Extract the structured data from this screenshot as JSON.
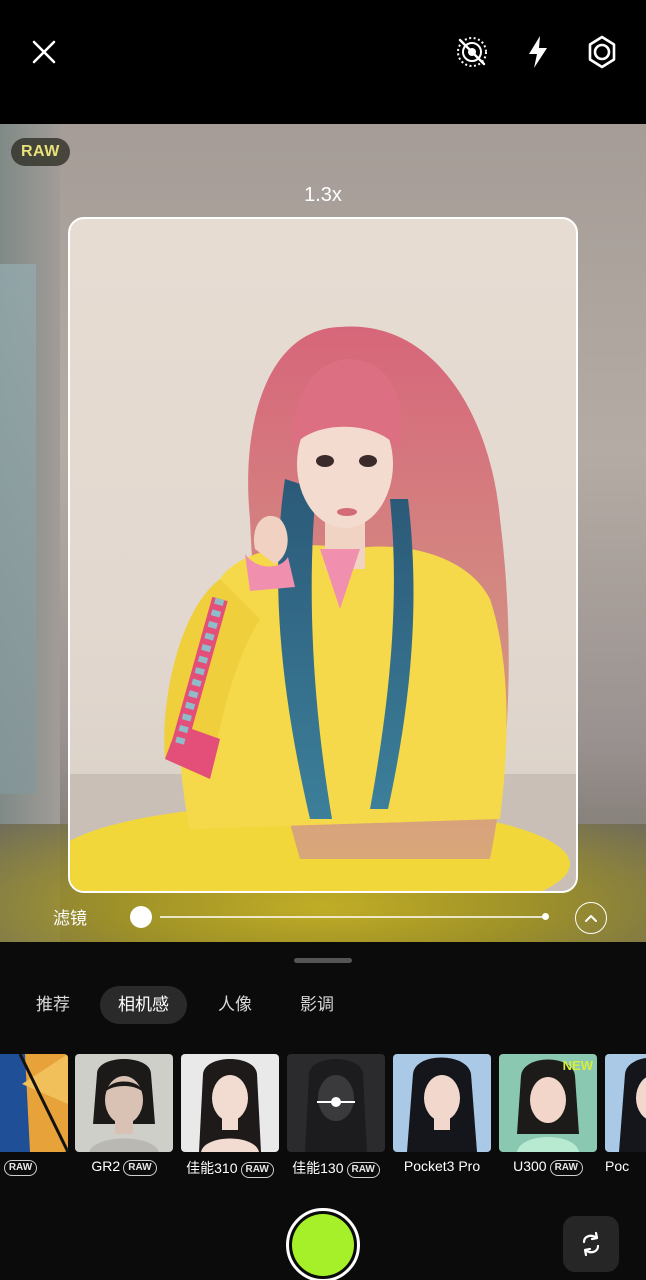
{
  "topbar": {
    "close_icon": "close-icon",
    "live_off_icon": "live-photo-off-icon",
    "flash_icon": "flash-icon",
    "settings_icon": "settings-icon"
  },
  "viewfinder": {
    "raw_badge": "RAW",
    "zoom": "1.3x",
    "filter_label": "滤镜",
    "filter_intensity": 0
  },
  "tabs": [
    {
      "label": "推荐",
      "active": false
    },
    {
      "label": "相机感",
      "active": true
    },
    {
      "label": "人像",
      "active": false
    },
    {
      "label": "影调",
      "active": false
    }
  ],
  "presets": [
    {
      "name": "",
      "raw": true,
      "new": false
    },
    {
      "name": "GR2",
      "raw": true,
      "new": false
    },
    {
      "name": "佳能310",
      "raw": true,
      "new": false
    },
    {
      "name": "佳能130",
      "raw": true,
      "new": false
    },
    {
      "name": "Pocket3 Pro",
      "raw": false,
      "new": false
    },
    {
      "name": "U300",
      "raw": true,
      "new": true
    },
    {
      "name": "Poc",
      "raw": false,
      "new": false
    }
  ],
  "raw_tag": "RAW",
  "new_tag": "NEW",
  "colors": {
    "shutter": "#a6f02a",
    "new_tag": "#d6ee3a",
    "raw_badge_text": "#e8e07a"
  }
}
